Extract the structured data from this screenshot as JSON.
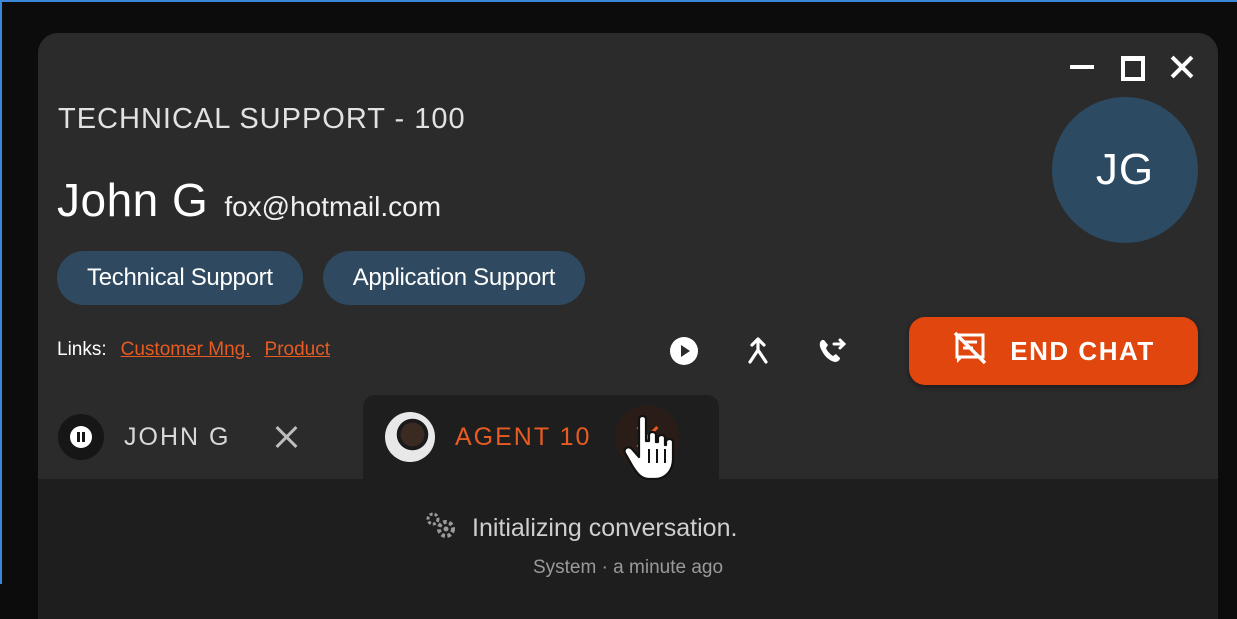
{
  "window": {
    "minimize_icon": "minimize-icon",
    "maximize_icon": "maximize-icon",
    "close_icon": "close-icon"
  },
  "header": {
    "queue_title": "TECHNICAL SUPPORT - 100",
    "contact_name": "John G",
    "contact_email": "fox@hotmail.com",
    "avatar_initials": "JG"
  },
  "tags": [
    "Technical Support",
    "Application Support"
  ],
  "links": {
    "label": "Links:",
    "items": [
      "Customer Mng.",
      "Product"
    ]
  },
  "actions": {
    "icons": [
      "play-icon",
      "merge-icon",
      "call-transfer-icon"
    ],
    "end_chat_label": "END CHAT",
    "end_chat_icon": "end-chat-icon"
  },
  "tabs": [
    {
      "label": "JOHN G",
      "icon": "pause-icon",
      "active": false
    },
    {
      "label": "AGENT 10",
      "icon": "agent-avatar",
      "active": true
    }
  ],
  "conversation": {
    "message": "Initializing conversation.",
    "meta": "System · a minute ago",
    "icon": "gears-icon"
  },
  "colors": {
    "accent": "#e0460e",
    "link": "#e85b22",
    "tag_bg": "#2f4a60",
    "avatar_bg": "#2d4a63",
    "panel_bg": "#2b2b2b",
    "content_bg": "#1e1e1e"
  }
}
